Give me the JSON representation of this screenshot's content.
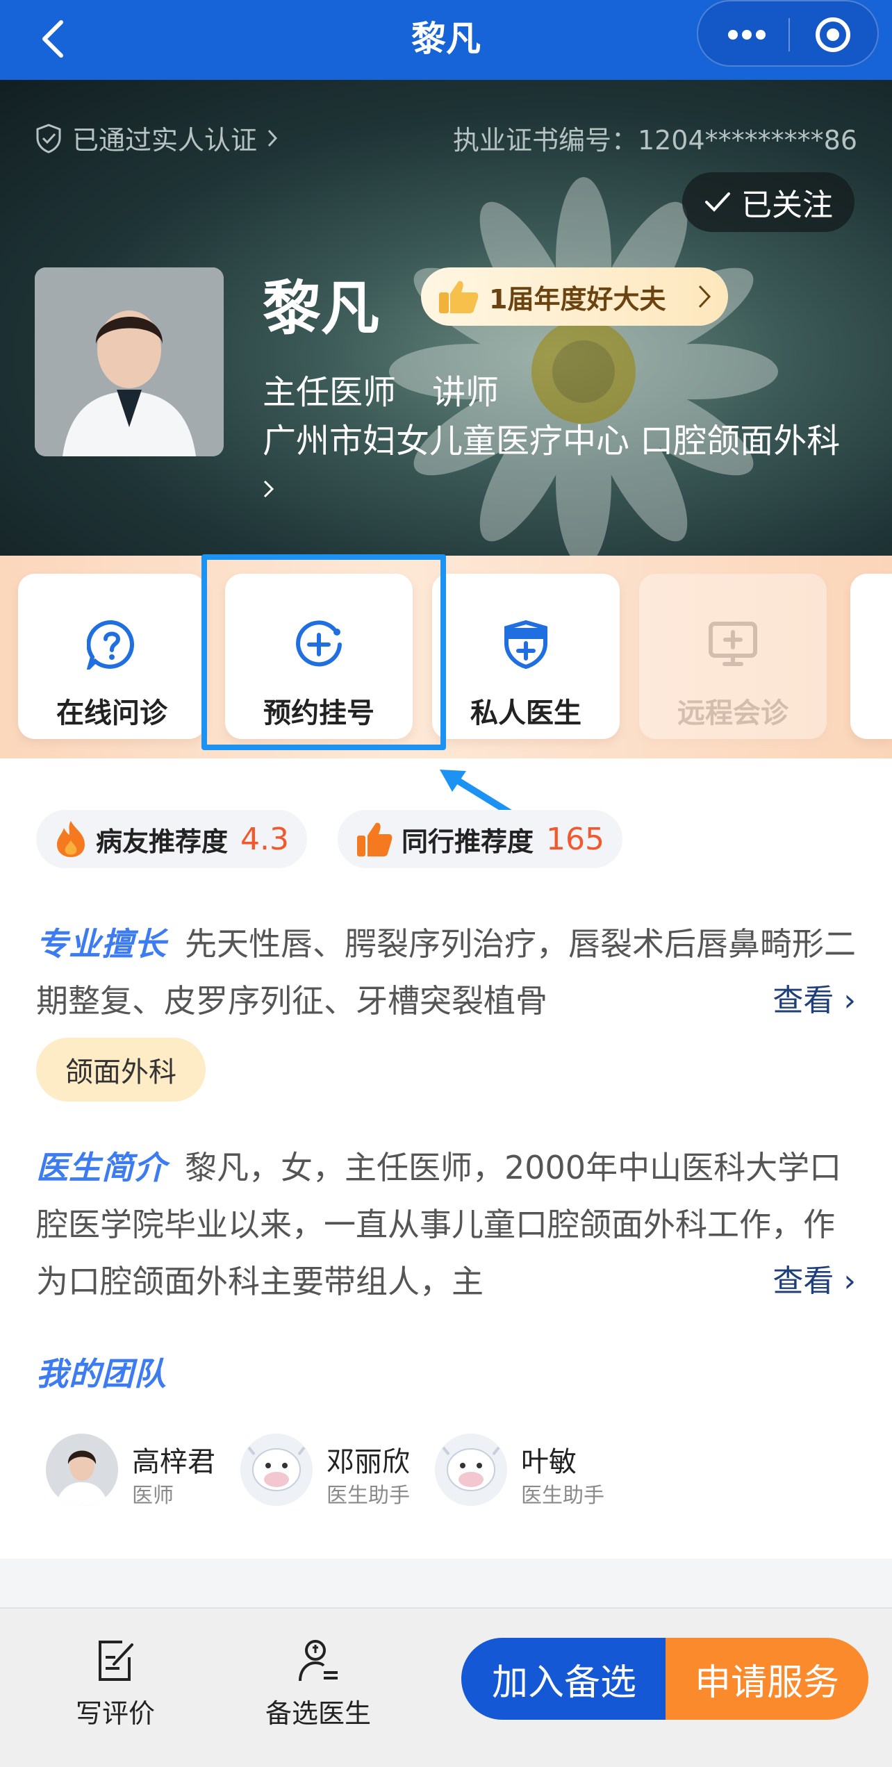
{
  "nav": {
    "title": "黎凡"
  },
  "hero": {
    "verified_text": "已通过实人认证",
    "license_text": "执业证书编号：1204*********86",
    "follow_label": "已关注",
    "doctor_name": "黎凡",
    "award_text": "1届年度好大夫",
    "title": "主任医师",
    "academic_title": "讲师",
    "hospital_dept": "广州市妇女儿童医疗中心   口腔颌面外科"
  },
  "services": [
    {
      "label": "在线问诊",
      "icon": "question-icon",
      "enabled": true
    },
    {
      "label": "预约挂号",
      "icon": "plus-clock-icon",
      "enabled": true,
      "highlighted": true
    },
    {
      "label": "私人医生",
      "icon": "shield-plus-icon",
      "enabled": true
    },
    {
      "label": "远程会诊",
      "icon": "monitor-plus-icon",
      "enabled": false
    }
  ],
  "ratings": {
    "patient_label": "病友推荐度",
    "patient_value": "4.3",
    "peer_label": "同行推荐度",
    "peer_value": "165"
  },
  "expertise": {
    "heading": "专业擅长",
    "text": "先天性唇、腭裂序列治疗，唇裂术后唇鼻畸形二期整复、皮罗序列征、牙槽突裂植骨",
    "more": "查看",
    "tag": "颌面外科"
  },
  "intro": {
    "heading": "医生简介",
    "text": "黎凡，女，主任医师，2000年中山医科大学口腔医学院毕业以来，一直从事儿童口腔颌面外科工作，作为口腔颌面外科主要带组人，主",
    "more": "查看"
  },
  "team": {
    "heading": "我的团队",
    "members": [
      {
        "name": "高梓君",
        "role": "医师"
      },
      {
        "name": "邓丽欣",
        "role": "医生助手"
      },
      {
        "name": "叶敏",
        "role": "医生助手"
      }
    ]
  },
  "bottom": {
    "review_label": "写评价",
    "candidates_label": "备选医生",
    "add_label": "加入备选",
    "apply_label": "申请服务"
  },
  "colors": {
    "brand_blue": "#1763d8",
    "highlight_blue": "#1c93f2",
    "orange": "#fb8a2c",
    "rating_red": "#f1582c"
  }
}
